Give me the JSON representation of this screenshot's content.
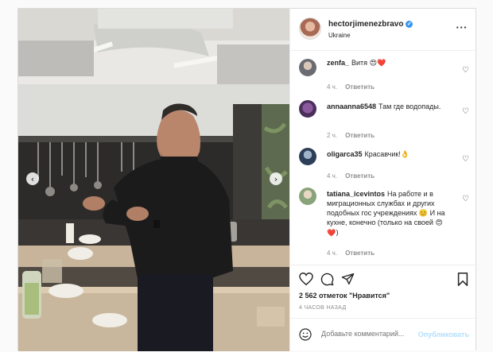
{
  "post": {
    "username": "hectorjimenezbravo",
    "location": "Ukraine",
    "verified_icon": "check",
    "more_label": "···"
  },
  "comments": [
    {
      "user": "zenfa_",
      "text": "Витя",
      "emoji": "😍❤️",
      "time": "4 ч.",
      "reply": "Ответить"
    },
    {
      "user": "annaanna6548",
      "text": "Там где водопады.",
      "emoji": "",
      "time": "2 ч.",
      "reply": "Ответить"
    },
    {
      "user": "oligarca35",
      "text": "Красавчик!",
      "emoji": "👌",
      "time": "4 ч.",
      "reply": "Ответить"
    },
    {
      "user": "tatiana_icevintos",
      "text": "На работе и в миграционных службах и других подобных гос учреждениях 😊 И на кухне, конечно (только на своей",
      "emoji": "😍❤️)",
      "time": "4 ч.",
      "reply": "Ответить"
    }
  ],
  "likes": "2 562 отметок \"Нравится\"",
  "timestamp": "4 ЧАСОВ НАЗАД",
  "add_comment": {
    "placeholder": "Добавьте комментарий...",
    "publish": "Опубликовать"
  },
  "colors": {
    "link_disabled": "#b2dffc",
    "verified": "#3897f0",
    "meta": "#8e8e8e"
  }
}
